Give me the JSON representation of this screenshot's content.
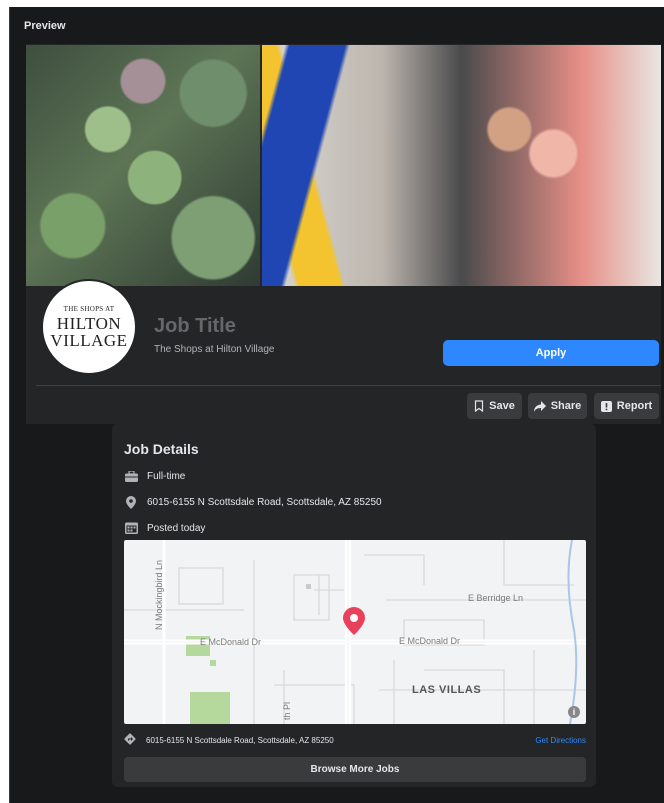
{
  "panel": {
    "label": "Preview"
  },
  "cover": {
    "left_image": "succulent-plants-photo",
    "right_image": "couple-with-shopping-bags-photo"
  },
  "logo": {
    "line1": "THE SHOPS AT",
    "line2": "HILTON",
    "line3": "VILLAGE"
  },
  "job": {
    "title": "Job Title",
    "company": "The Shops at Hilton Village",
    "apply_label": "Apply"
  },
  "actions": {
    "save_label": "Save",
    "share_label": "Share",
    "report_label": "Report"
  },
  "details": {
    "heading": "Job Details",
    "employment_type": "Full-time",
    "address": "6015-6155 N Scottsdale Road, Scottsdale, AZ 85250",
    "posted": "Posted today"
  },
  "map": {
    "labels": {
      "mockingbird": "N Mockingbird Ln",
      "berridge": "E Berridge Ln",
      "mcdonald_west": "E McDonald Dr",
      "mcdonald_east": "E McDonald Dr",
      "las_villas": "LAS VILLAS",
      "pl": "th Pl"
    },
    "info_glyph": "i"
  },
  "location": {
    "address": "6015-6155 N Scottsdale Road, Scottsdale, AZ 85250",
    "directions_label": "Get Directions"
  },
  "browse": {
    "label": "Browse More Jobs"
  },
  "colors": {
    "background": "#18191a",
    "card": "#242526",
    "button": "#3a3b3c",
    "accent": "#2d88ff",
    "pin": "#e9415b"
  },
  "icons": {
    "save": "bookmark-icon",
    "share": "share-arrow-icon",
    "report": "report-flag-icon",
    "employment": "briefcase-icon",
    "address": "location-pin-icon",
    "posted": "calendar-icon",
    "directions": "directions-icon"
  }
}
